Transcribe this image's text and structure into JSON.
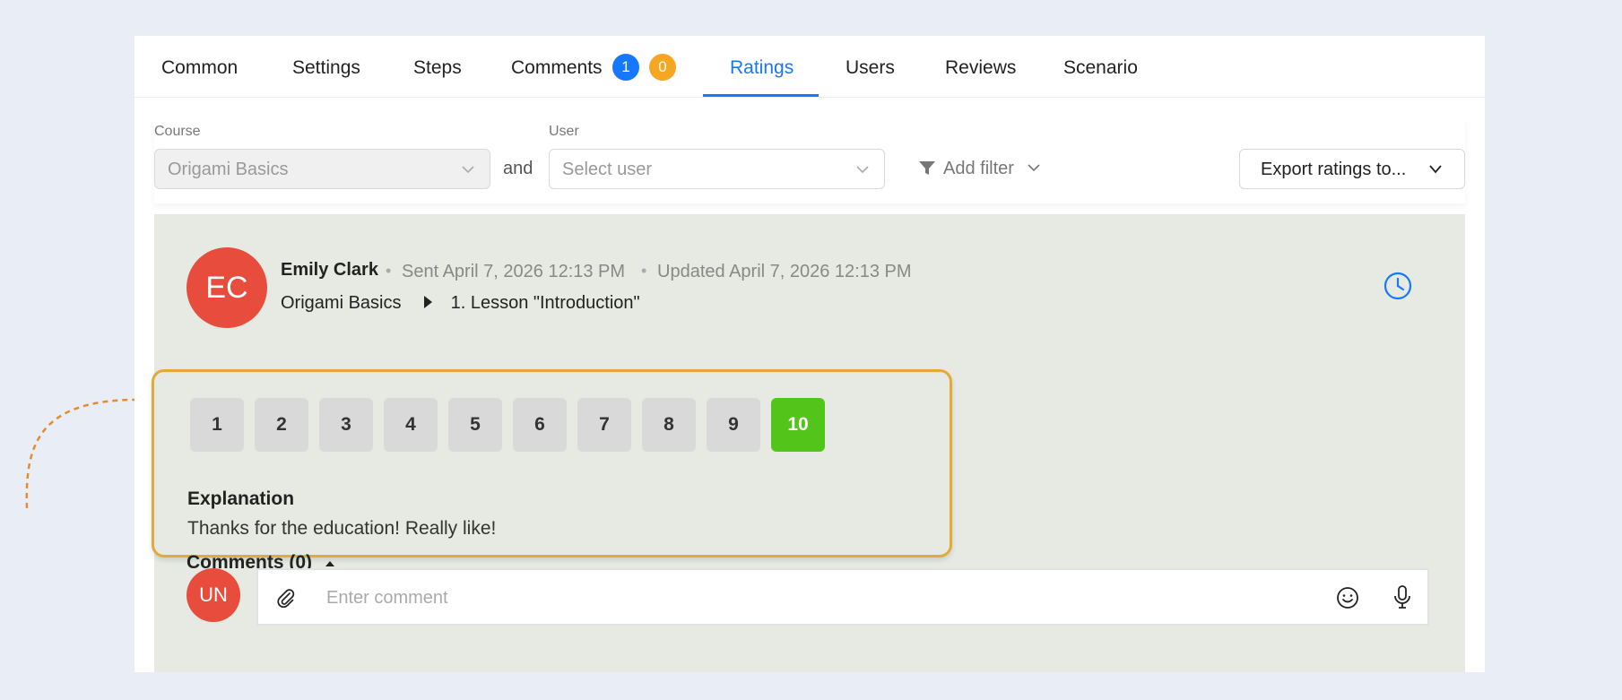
{
  "tabs": [
    {
      "label": "Common"
    },
    {
      "label": "Settings"
    },
    {
      "label": "Steps"
    },
    {
      "label": "Comments",
      "badges": [
        "1",
        "0"
      ]
    },
    {
      "label": "Ratings"
    },
    {
      "label": "Users"
    },
    {
      "label": "Reviews"
    },
    {
      "label": "Scenario"
    }
  ],
  "active_tab": "Ratings",
  "filters": {
    "course_label": "Course",
    "course_value": "Origami Basics",
    "and_text": "and",
    "user_label": "User",
    "user_placeholder": "Select user",
    "add_filter": "Add filter",
    "export_label": "Export ratings to..."
  },
  "rating": {
    "avatar_initials": "EC",
    "user_name": "Emily Clark",
    "sent": "Sent April 7, 2026 12:13 PM",
    "updated": "Updated April 7, 2026 12:13 PM",
    "course": "Origami Basics",
    "lesson": "1. Lesson \"Introduction\"",
    "scores": [
      "1",
      "2",
      "3",
      "4",
      "5",
      "6",
      "7",
      "8",
      "9",
      "10"
    ],
    "selected_score": 10,
    "explanation_title": "Explanation",
    "explanation_text": "Thanks for the education! Really like!"
  },
  "comments": {
    "toggle_label": "Comments (0)",
    "current_user_initials": "UN",
    "input_placeholder": "Enter comment"
  },
  "colors": {
    "accent": "#1677ff",
    "badge_orange": "#f5a623",
    "selected_score": "#52c41a",
    "avatar": "#e84c3d",
    "highlight_border": "#e5a93a",
    "card_bg": "#e6eae3"
  },
  "icons": [
    "chevron-down-icon",
    "filter-icon",
    "clock-icon",
    "caret-right-icon",
    "caret-up-icon",
    "paperclip-icon",
    "smile-icon",
    "microphone-icon"
  ]
}
